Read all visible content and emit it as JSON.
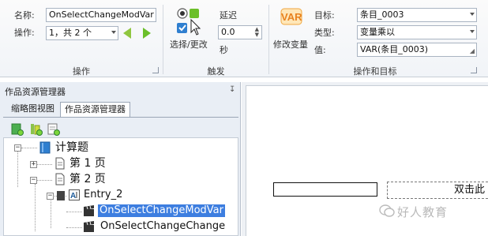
{
  "ribbon": {
    "name_label": "名称:",
    "name_value": "OnSelectChangeModVar",
    "operation_label": "操作:",
    "operation_value": "1，共 2 个",
    "group_operation": "操作",
    "trigger_button_label": "选择/更改",
    "delay_label": "延迟",
    "delay_value": "0.0",
    "delay_unit": "秒",
    "group_trigger": "触发",
    "modify_var_icon_text": "VAR",
    "modify_var_label": "修改变量",
    "target_label": "目标:",
    "target_value": "条目_0003",
    "type_label": "类型:",
    "type_value": "变量乘以",
    "value_label": "值:",
    "value_value": "VAR(条目_0003)",
    "group_op_target": "操作和目标"
  },
  "panel": {
    "title": "作品资源管理器",
    "pin_glyph": "↧",
    "tabs": [
      {
        "label": "缩略图视图",
        "active": false
      },
      {
        "label": "作品资源管理器",
        "active": true
      }
    ]
  },
  "tree": {
    "root": "计算题",
    "page1": "第 1 页",
    "page2": "第 2 页",
    "entry": "Entry_2",
    "action1": "OnSelectChangeModVar",
    "action2": "OnSelectChangeChange",
    "minus": "−",
    "plus": "+"
  },
  "canvas": {
    "prompt_text": "双击此",
    "watermark": "好人教育"
  },
  "colors": {
    "accent": "#3d7ee0",
    "green": "#6bbf2a",
    "var_orange": "#e8821e"
  }
}
